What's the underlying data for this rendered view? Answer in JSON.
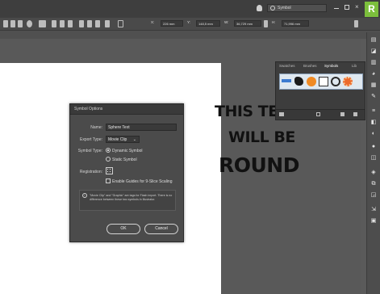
{
  "topbar": {
    "search_value": "Symbol",
    "badge": "R"
  },
  "toolbar": {
    "x_value": "226 mm",
    "y_value": "148,5 mm",
    "w_value": "36,729 mm",
    "h_value": "71,996 mm",
    "x_label": "X:",
    "y_label": "Y:",
    "w_label": "W:",
    "h_label": "H:"
  },
  "panel": {
    "tabs": [
      "Swatches",
      "Brushes",
      "Symbols",
      "Lib"
    ],
    "active_tab": "Symbols"
  },
  "dialog": {
    "title": "Symbol Options",
    "name_label": "Name:",
    "name_value": "Sphere Text",
    "export_type_label": "Export Type:",
    "export_type_value": "Movie Clip",
    "symbol_type_label": "Symbol Type:",
    "dynamic_label": "Dynamic Symbol",
    "static_label": "Static Symbol",
    "registration_label": "Registration:",
    "guides_label": "Enable Guides for 9-Slice Scaling",
    "info_text": "\"Movie Clip\" and \"Graphic\" are tags for Flash import. There is no difference between these two symbols in Illustrator.",
    "ok_label": "OK",
    "cancel_label": "Cancel"
  },
  "canvas_text": {
    "line1": "THIS TE",
    "line2": "WILL BE",
    "line3": "ROUND"
  }
}
